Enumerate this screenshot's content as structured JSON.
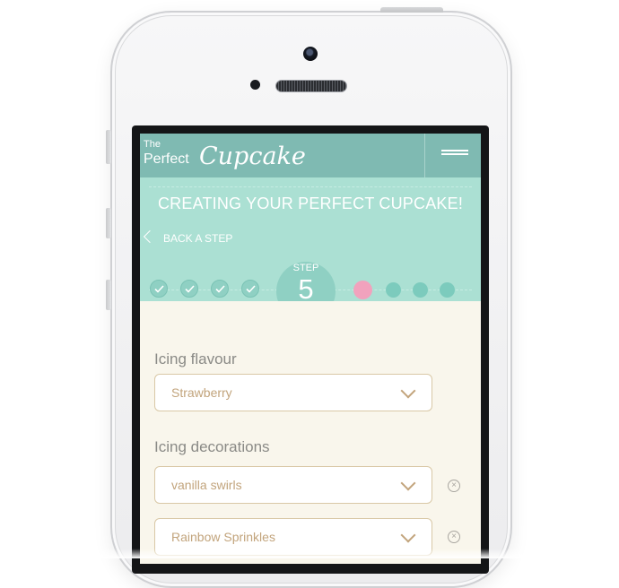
{
  "header": {
    "logo_the": "The",
    "logo_perfect": "Perfect",
    "logo_cupcake": "Cupcake"
  },
  "steps": {
    "headline": "CREATING YOUR PERFECT CUPCAKE!",
    "back_label": "BACK A STEP",
    "step_label": "STEP",
    "current_step": "5",
    "completed_steps": 4,
    "remaining_steps": 3,
    "icons": {
      "done": "check-icon",
      "back": "chevron-left-icon",
      "menu": "hamburger-menu-icon"
    }
  },
  "form": {
    "icing_flavour_label": "Icing flavour",
    "icing_flavour_value": "Strawberry",
    "icing_decorations_label": "Icing decorations",
    "decorations": [
      "vanilla swirls",
      "Rainbow Sprinkles"
    ]
  },
  "colors": {
    "header": "#7fbab2",
    "teal": "#abe0d3",
    "accent_pink": "#f1a2bd",
    "cream": "#f9f6ec",
    "field_text": "#c2a47c"
  }
}
